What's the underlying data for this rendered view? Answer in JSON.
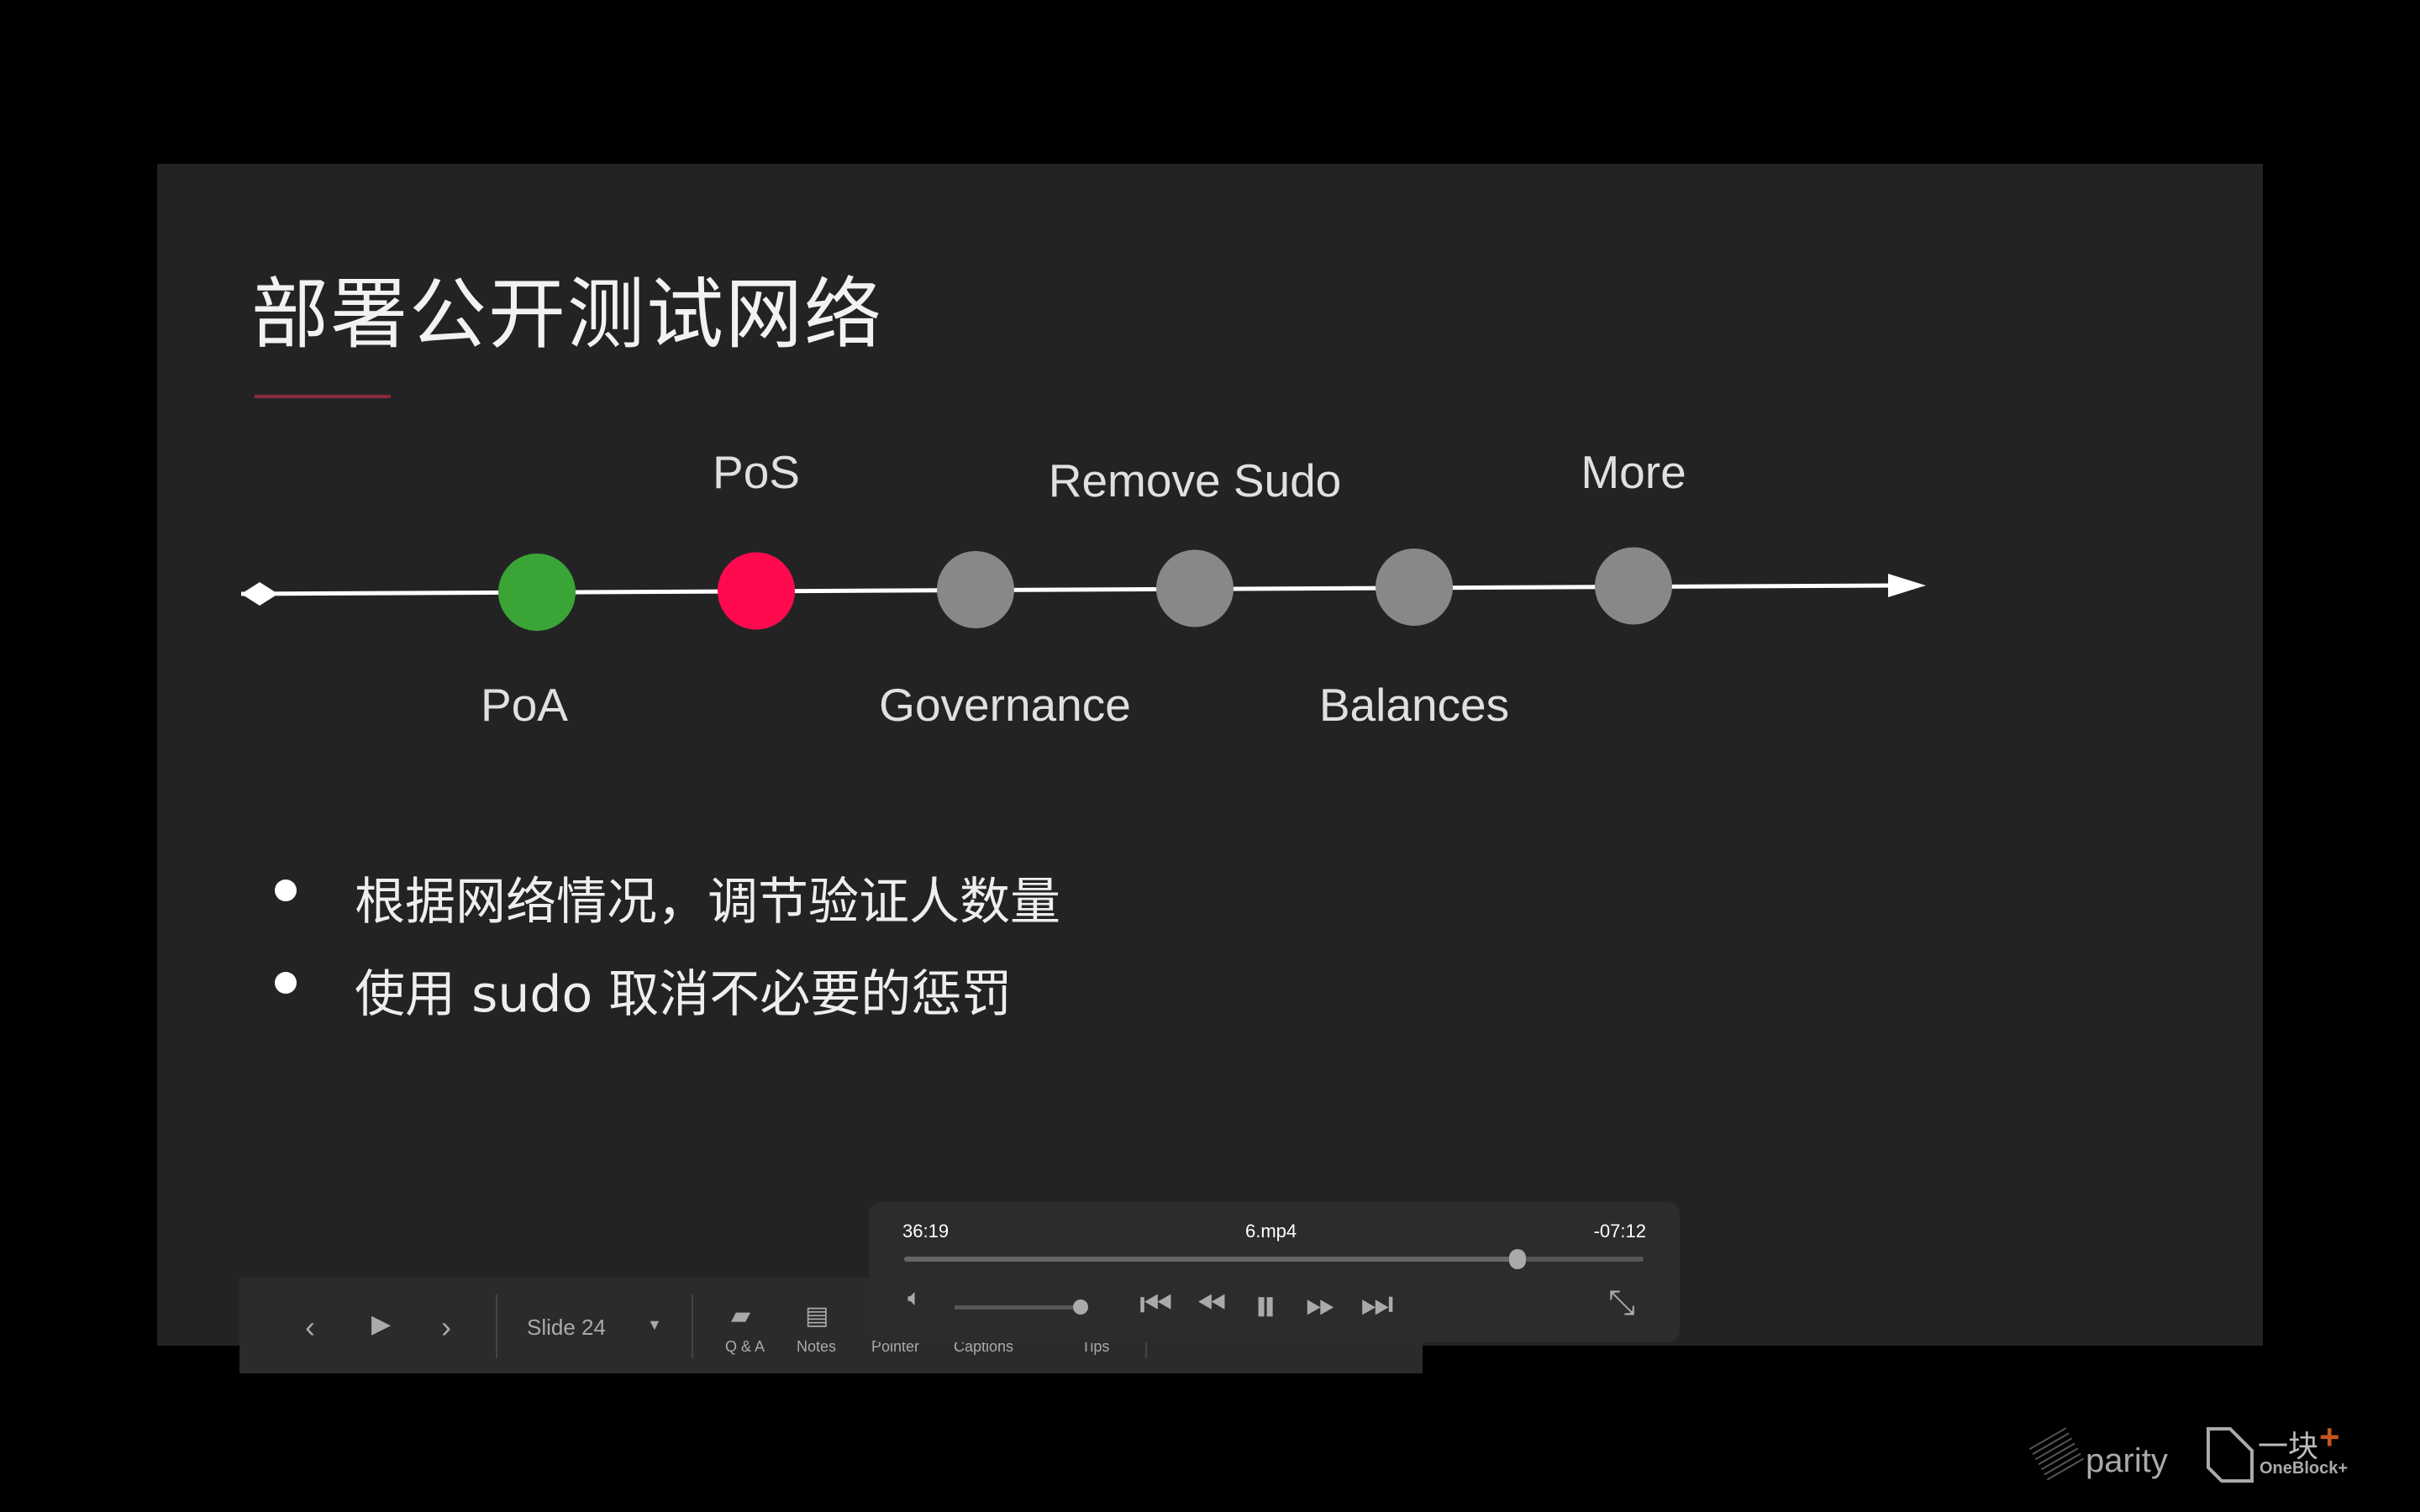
{
  "slide": {
    "title": "部署公开测试网络",
    "timeline": {
      "stages": [
        {
          "label": "PoA",
          "color": "#3aa536",
          "position": "below"
        },
        {
          "label": "PoS",
          "color": "#ff0a4f",
          "position": "above"
        },
        {
          "label": "Governance",
          "color": "#888888",
          "position": "below"
        },
        {
          "label": "Remove Sudo",
          "color": "#888888",
          "position": "above"
        },
        {
          "label": "Balances",
          "color": "#888888",
          "position": "below"
        },
        {
          "label": "More",
          "color": "#888888",
          "position": "above"
        }
      ]
    },
    "bullets": [
      "根据网络情况，调节验证人数量",
      "使用 sudo 取消不必要的惩罚"
    ],
    "logos": {
      "parity": "parity",
      "oneblock_cn": "一块",
      "oneblock": "OneBlock+"
    }
  },
  "toolbar": {
    "slide_label": "Slide 24",
    "qa": "Q & A",
    "notes": "Notes",
    "pointer": "Pointer",
    "captions": "Captions",
    "tips": "Tips"
  },
  "player": {
    "elapsed": "36:19",
    "filename": "6.mp4",
    "remaining": "-07:12",
    "progress": 0.83,
    "volume": 1.0
  }
}
